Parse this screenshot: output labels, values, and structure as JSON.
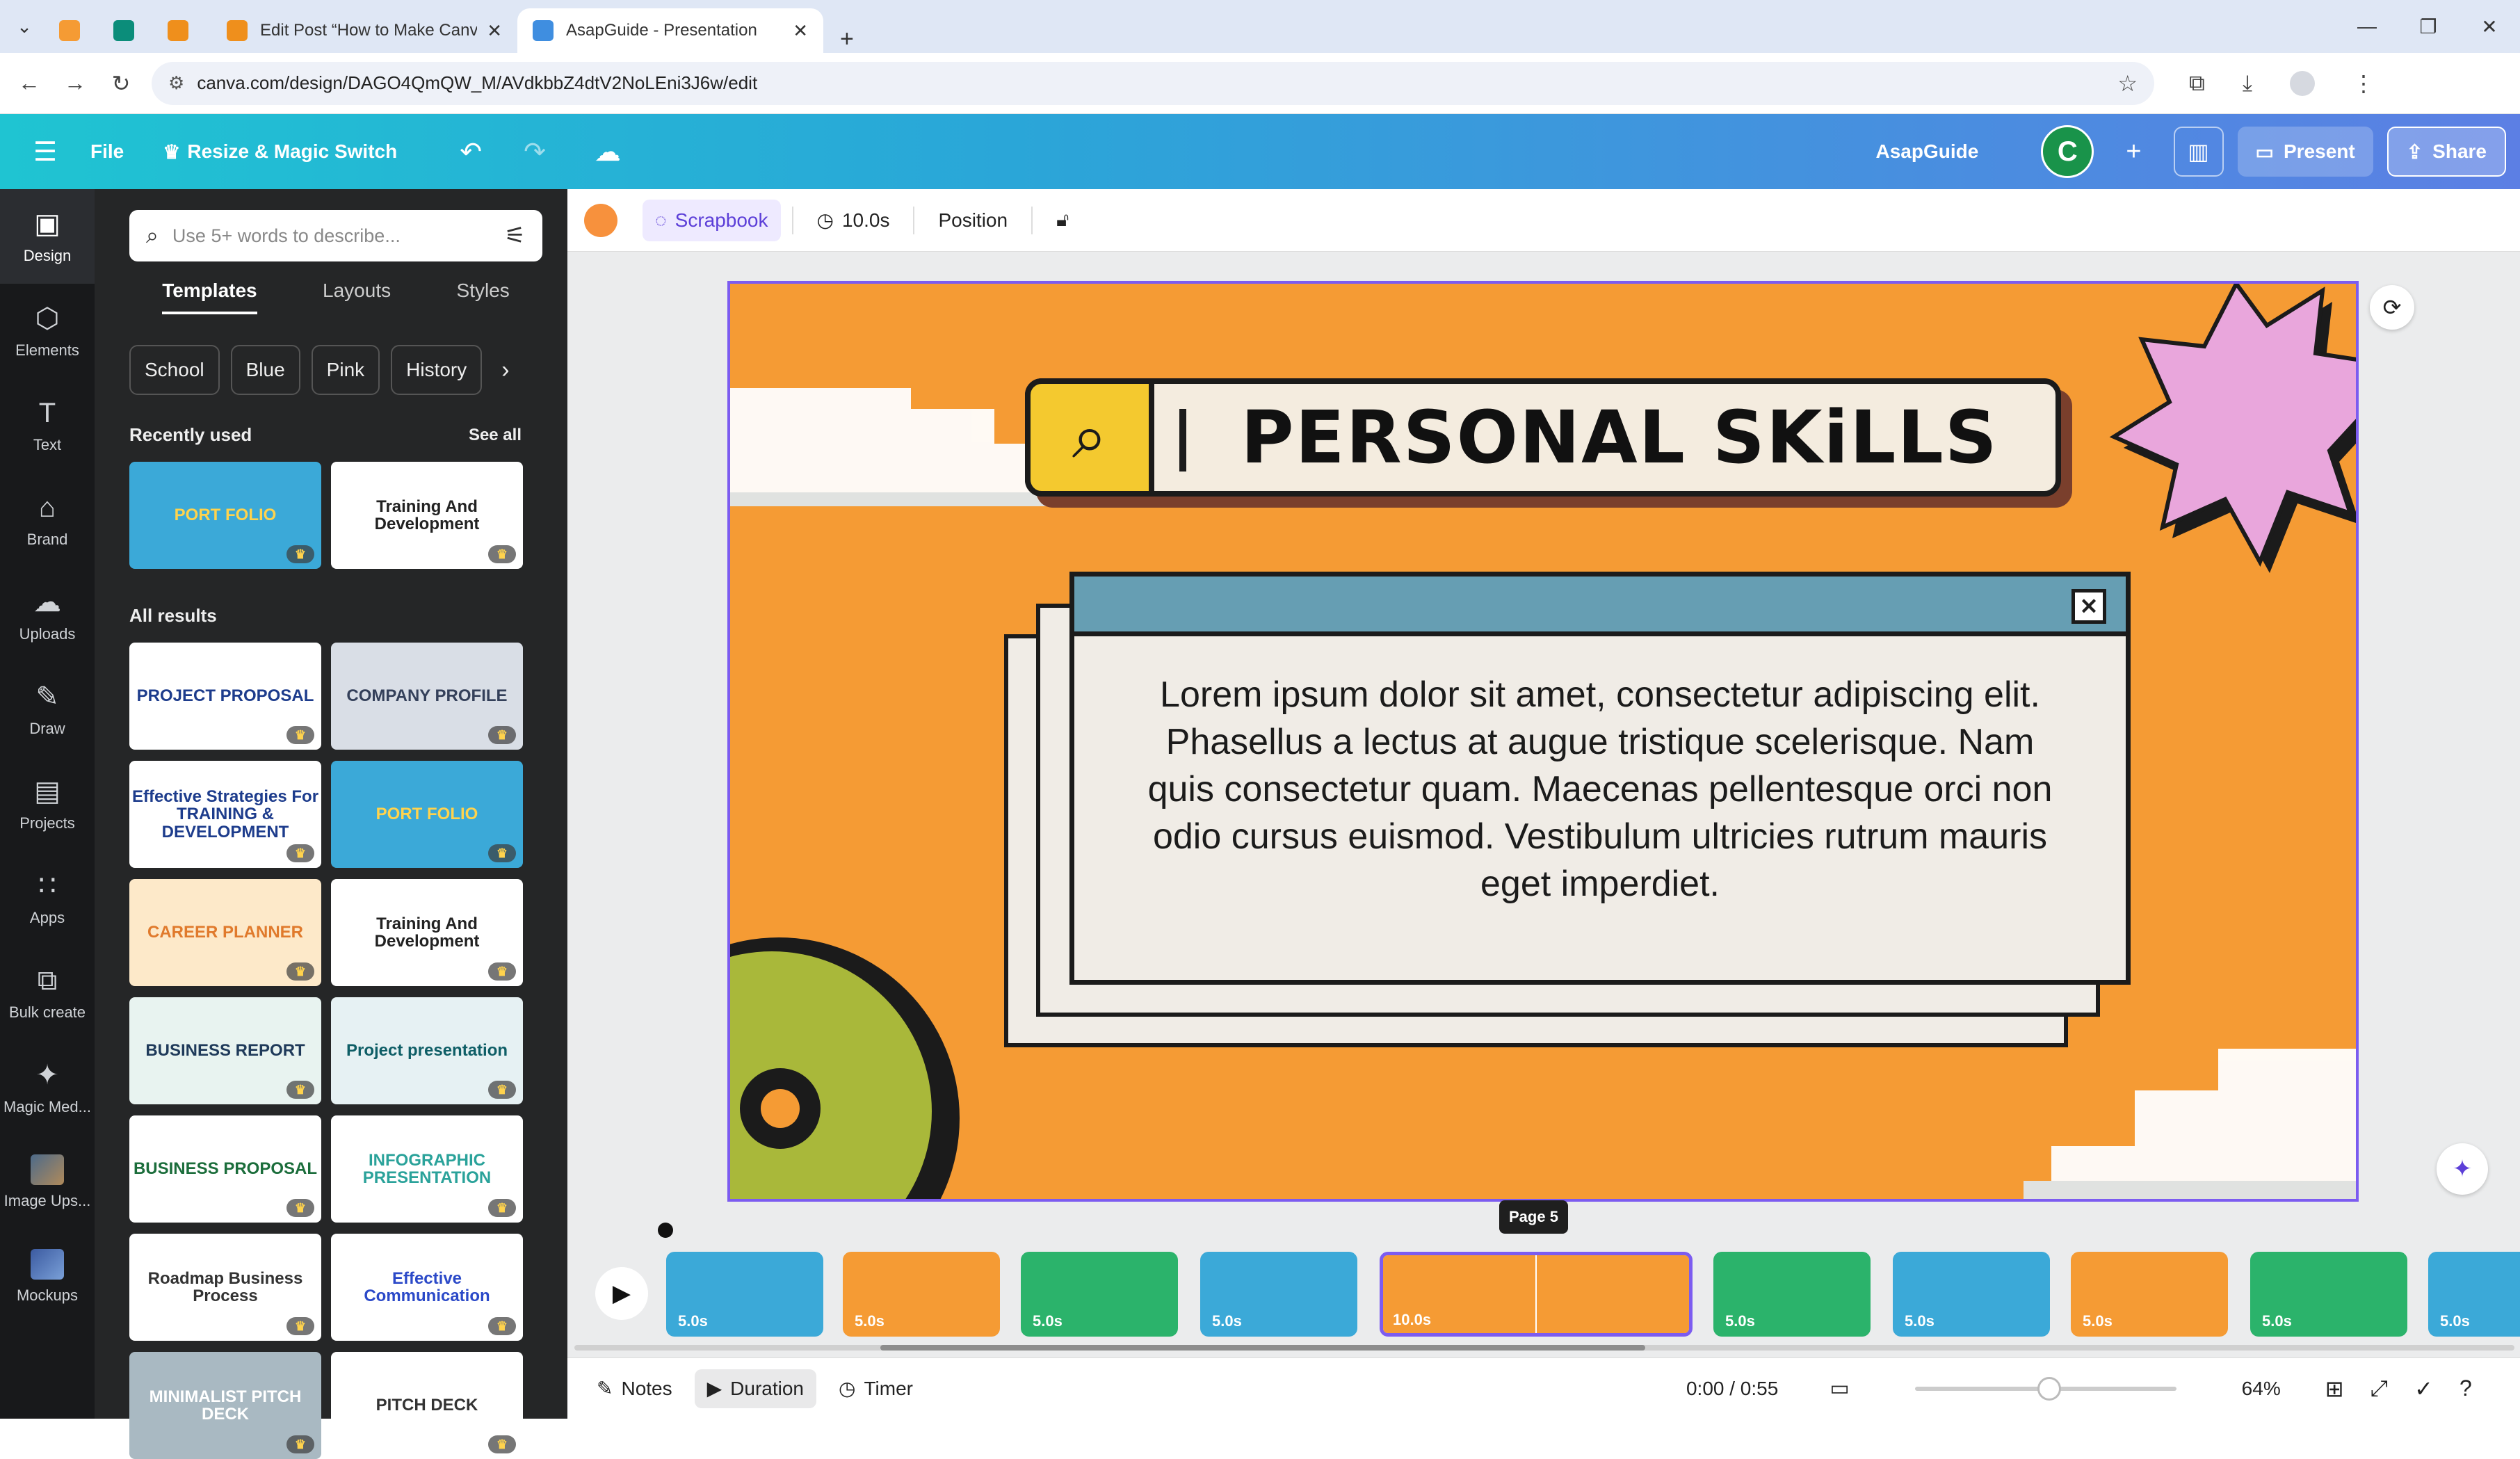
{
  "browser": {
    "tabs": [
      {
        "title": "",
        "color": "#f59b34"
      },
      {
        "title": "",
        "color": "#0b8d7a"
      },
      {
        "title": "",
        "color": "#ef8f1c"
      },
      {
        "title": "Edit Post “How to Make Canva",
        "color": "#ef8f1c"
      },
      {
        "title": "AsapGuide - Presentation",
        "color": "#3f8ee0"
      }
    ],
    "url": "canva.com/design/DAGO4QmQW_M/AVdkbbZ4dtV2NoLEni3J6w/edit"
  },
  "topbar": {
    "file": "File",
    "magic_switch": "Resize & Magic Switch",
    "project_name": "AsapGuide",
    "user_initial": "C",
    "present": "Present",
    "share": "Share"
  },
  "rail": [
    {
      "label": "Design",
      "icon": "design-icon",
      "glyph": "▣"
    },
    {
      "label": "Elements",
      "icon": "elements-icon",
      "glyph": "⬡"
    },
    {
      "label": "Text",
      "icon": "text-icon",
      "glyph": "T"
    },
    {
      "label": "Brand",
      "icon": "brand-icon",
      "glyph": "⌂"
    },
    {
      "label": "Uploads",
      "icon": "uploads-icon",
      "glyph": "☁"
    },
    {
      "label": "Draw",
      "icon": "draw-icon",
      "glyph": "✎"
    },
    {
      "label": "Projects",
      "icon": "projects-icon",
      "glyph": "▤"
    },
    {
      "label": "Apps",
      "icon": "apps-icon",
      "glyph": "∷"
    },
    {
      "label": "Bulk create",
      "icon": "bulk-create-icon",
      "glyph": "⧉"
    },
    {
      "label": "Magic Med...",
      "icon": "magic-media-icon",
      "glyph": "✦"
    },
    {
      "label": "Image Ups...",
      "icon": "image-upscaler-icon",
      "glyph": "▩"
    },
    {
      "label": "Mockups",
      "icon": "mockups-icon",
      "glyph": "▩"
    }
  ],
  "panel": {
    "search_placeholder": "Use 5+ words to describe...",
    "tabs": [
      "Templates",
      "Layouts",
      "Styles"
    ],
    "chips": [
      "School",
      "Blue",
      "Pink",
      "History"
    ],
    "recently_used": "Recently used",
    "see_all": "See all",
    "all_results": "All results",
    "recent": [
      {
        "label": "PORT FOLIO",
        "bg": "#3ba9d8",
        "fg": "#ffd34d"
      },
      {
        "label": "Training And Development",
        "bg": "#ffffff",
        "fg": "#222222"
      }
    ],
    "results": [
      {
        "label": "PROJECT PROPOSAL",
        "bg": "#ffffff",
        "fg": "#1d3c8c"
      },
      {
        "label": "COMPANY PROFILE",
        "bg": "#d9dee6",
        "fg": "#34405a"
      },
      {
        "label": "Effective Strategies For TRAINING & DEVELOPMENT",
        "bg": "#ffffff",
        "fg": "#1d3c8c"
      },
      {
        "label": "PORT FOLIO",
        "bg": "#3ba9d8",
        "fg": "#ffd34d"
      },
      {
        "label": "CAREER PLANNER",
        "bg": "#fde9c9",
        "fg": "#e07a2c"
      },
      {
        "label": "Training And Development",
        "bg": "#ffffff",
        "fg": "#222222"
      },
      {
        "label": "BUSINESS REPORT",
        "bg": "#e8f3f0",
        "fg": "#1f3a5a"
      },
      {
        "label": "Project presentation",
        "bg": "#e6f1f3",
        "fg": "#0e5e66"
      },
      {
        "label": "BUSINESS PROPOSAL",
        "bg": "#ffffff",
        "fg": "#1b6d3b"
      },
      {
        "label": "INFOGRAPHIC PRESENTATION",
        "bg": "#ffffff",
        "fg": "#2aa29a"
      },
      {
        "label": "Roadmap Business Process",
        "bg": "#ffffff",
        "fg": "#333333"
      },
      {
        "label": "Effective Communication",
        "bg": "#ffffff",
        "fg": "#2b49c8"
      },
      {
        "label": "MINIMALIST PITCH DECK",
        "bg": "#a9b9c2",
        "fg": "#ffffff"
      },
      {
        "label": "PITCH DECK",
        "bg": "#ffffff",
        "fg": "#333333"
      }
    ]
  },
  "toolbar": {
    "accent": "#f7913d",
    "animation": "Scrapbook",
    "duration": "10.0s",
    "position": "Position"
  },
  "slide": {
    "title": "PERSONAL SKiLLS",
    "body": "Lorem ipsum dolor sit amet, consectetur adipiscing elit. Phasellus a lectus at augue tristique scelerisque. Nam quis consectetur quam. Maecenas pellentesque orci non odio cursus euismod. Vestibulum ultricies rutrum mauris eget imperdiet.",
    "background": "#f59b34",
    "window_bar": "#669eb3"
  },
  "timeline": {
    "page_tooltip": "Page 5",
    "frames": [
      {
        "duration": "5.0s",
        "bg": "#3ba9d8"
      },
      {
        "duration": "5.0s",
        "bg": "#f59b34"
      },
      {
        "duration": "5.0s",
        "bg": "#2bb36b"
      },
      {
        "duration": "5.0s",
        "bg": "#3ba9d8"
      },
      {
        "duration": "10.0s",
        "bg": "#f59b34"
      },
      {
        "duration": "5.0s",
        "bg": "#2bb36b"
      },
      {
        "duration": "5.0s",
        "bg": "#3ba9d8"
      },
      {
        "duration": "5.0s",
        "bg": "#f59b34"
      },
      {
        "duration": "5.0s",
        "bg": "#2bb36b"
      },
      {
        "duration": "5.0s",
        "bg": "#3ba9d8"
      }
    ]
  },
  "bottom": {
    "notes": "Notes",
    "duration": "Duration",
    "timer": "Timer",
    "time": "0:00 / 0:55",
    "zoom": "64%"
  }
}
